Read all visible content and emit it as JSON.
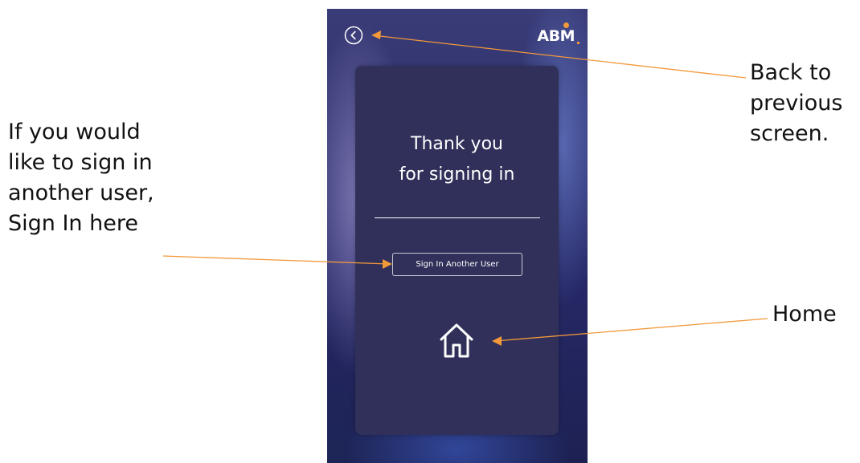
{
  "callouts": {
    "left": [
      "If you would",
      "like to sign in",
      "another user,",
      "Sign In here"
    ],
    "back": [
      "Back to",
      "previous",
      "screen."
    ],
    "home": "Home"
  },
  "app": {
    "logo_text": "ABM",
    "back_icon": "chevron-left-circle-icon",
    "home_icon": "home-icon"
  },
  "card": {
    "title_line1": "Thank you",
    "title_line2": "for signing in",
    "sign_in_button_label": "Sign In Another User"
  },
  "colors": {
    "accent_orange": "#f2993a",
    "card_bg": "#30305a",
    "phone_bg": "#2d2f6c",
    "text_white": "#ffffff"
  }
}
